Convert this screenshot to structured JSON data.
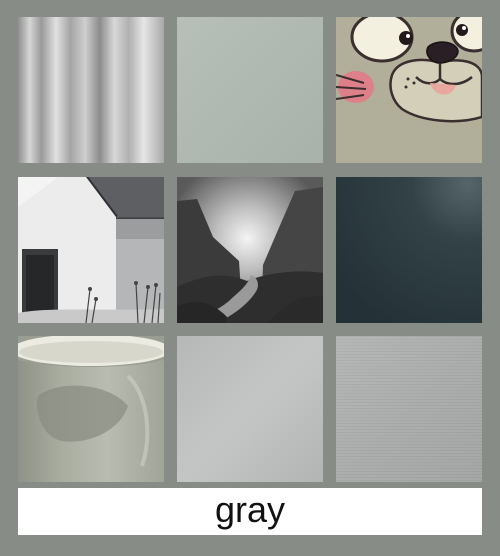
{
  "grid": {
    "tiles": [
      {
        "name": "curtain-fabric"
      },
      {
        "name": "sage-gray-swatch"
      },
      {
        "name": "cartoon-cat-face"
      },
      {
        "name": "white-cottage"
      },
      {
        "name": "mountain-valley"
      },
      {
        "name": "dark-teal-surface"
      },
      {
        "name": "ceramic-mug"
      },
      {
        "name": "gray-gradient-swatch"
      },
      {
        "name": "gray-texture-swatch"
      }
    ]
  },
  "label": {
    "text": "gray"
  }
}
